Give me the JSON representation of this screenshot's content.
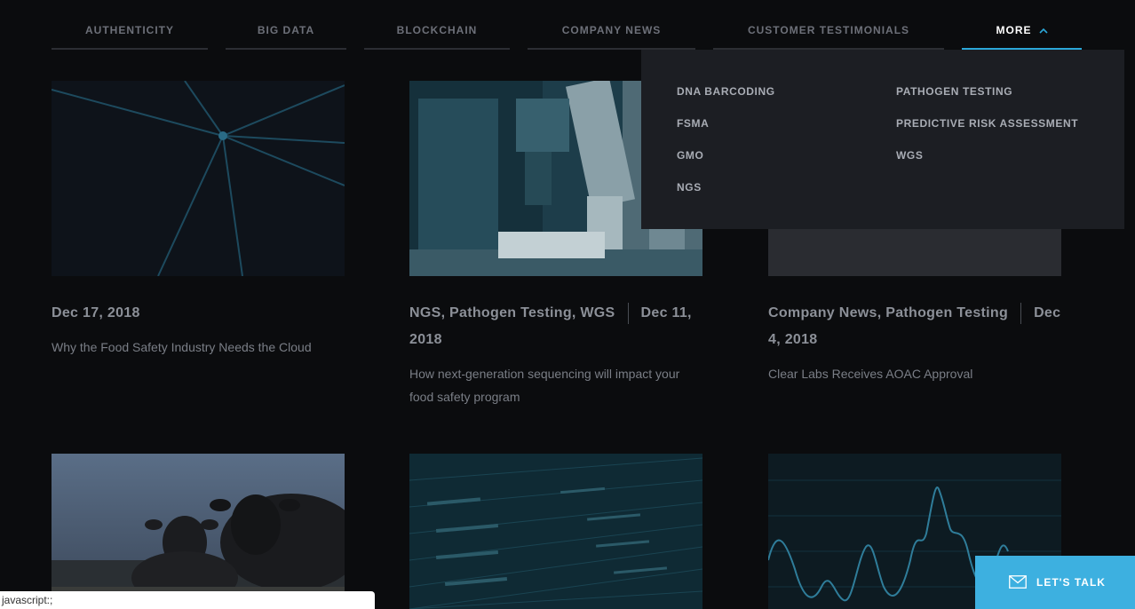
{
  "nav": {
    "items": [
      {
        "label": "AUTHENTICITY"
      },
      {
        "label": "BIG DATA"
      },
      {
        "label": "BLOCKCHAIN"
      },
      {
        "label": "COMPANY NEWS"
      },
      {
        "label": "CUSTOMER TESTIMONIALS"
      },
      {
        "label": "MORE"
      }
    ]
  },
  "dropdown": {
    "left_column": [
      "DNA BARCODING",
      "FSMA",
      "GMO",
      "NGS"
    ],
    "right_column": [
      "PATHOGEN TESTING",
      "PREDICTIVE RISK ASSESSMENT",
      "WGS"
    ]
  },
  "posts": [
    {
      "categories": "",
      "date": "Dec 17, 2018",
      "excerpt": "Why the Food Safety Industry Needs the Cloud"
    },
    {
      "categories": "NGS, Pathogen Testing, WGS",
      "date_line1": "Dec 11,",
      "date_line2": "2018",
      "excerpt_line1": "How next-generation sequencing will impact your",
      "excerpt_line2": "food safety program"
    },
    {
      "categories": "Company News, Pathogen Testing",
      "date_line1": "Dec",
      "date_line2": "4, 2018",
      "excerpt": "Clear Labs Receives AOAC Approval"
    }
  ],
  "status_bar": {
    "text": "javascript:;"
  },
  "cta": {
    "label": "LET'S TALK"
  },
  "colors": {
    "accent": "#3db0e0",
    "background": "#0b0c0e",
    "dropdown_bg": "#1c1e23"
  }
}
